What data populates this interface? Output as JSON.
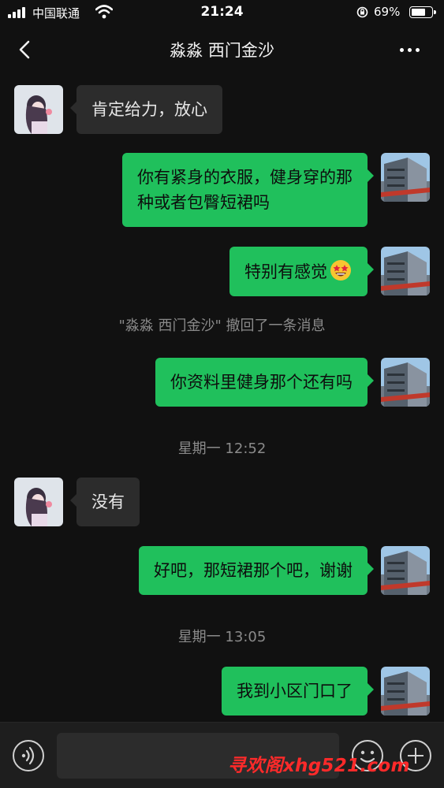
{
  "status_bar": {
    "carrier": "中国联通",
    "time": "21:24",
    "battery_percent": "69%",
    "battery_level": 0.69
  },
  "nav": {
    "title": "淼淼 西门金沙",
    "back_icon": "chevron-left-icon",
    "more_icon": "more-dots-icon"
  },
  "messages": [
    {
      "side": "left",
      "text": "肯定给力，放心"
    },
    {
      "side": "right",
      "lines": [
        "你有紧身的衣服，健身穿的那",
        "种或者包臀短裙吗"
      ]
    },
    {
      "side": "right",
      "text": "特别有感觉",
      "emoji": "star-struck-emoji"
    },
    {
      "type": "system",
      "text": "\"淼淼 西门金沙\" 撤回了一条消息"
    },
    {
      "side": "right",
      "text": "你资料里健身那个还有吗"
    },
    {
      "type": "timestamp",
      "text": "星期一 12:52"
    },
    {
      "side": "left",
      "text": "没有"
    },
    {
      "side": "right",
      "text": "好吧，那短裙那个吧，谢谢"
    },
    {
      "type": "timestamp",
      "text": "星期一 13:05"
    },
    {
      "side": "right",
      "text": "我到小区门口了"
    }
  ],
  "input_bar": {
    "voice_icon": "voice-icon",
    "emoji_icon": "emoji-face-icon",
    "plus_icon": "plus-icon"
  },
  "watermark": "寻欢阁xhg521.com",
  "colors": {
    "background": "#111111",
    "outgoing_bubble": "#20c05c",
    "incoming_bubble": "#2c2c2c",
    "watermark": "#ff2a2a"
  }
}
